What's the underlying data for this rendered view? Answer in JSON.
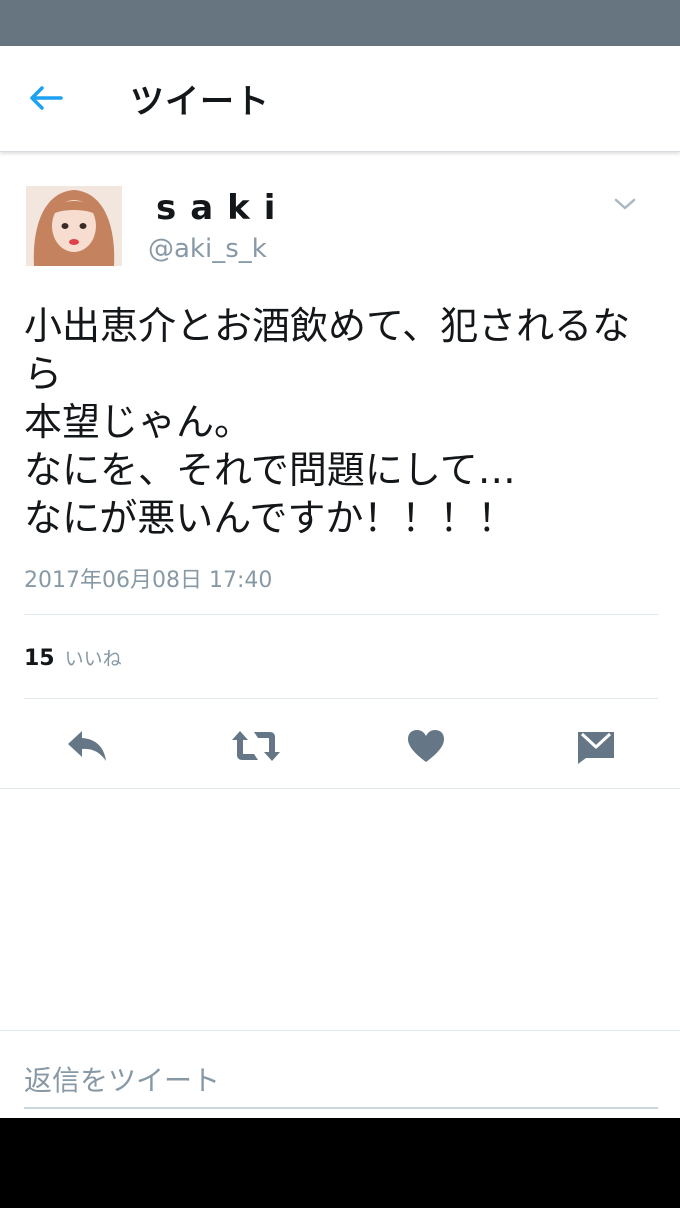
{
  "header": {
    "title": "ツイート"
  },
  "tweet": {
    "display_name": "saki",
    "handle": "@aki_s_k",
    "text": "小出恵介とお酒飲めて、犯されるなら\n本望じゃん。\nなにを、それで問題にして…\nなにが悪いんですか！！！！",
    "timestamp": "2017年06月08日 17:40",
    "likes_count": "15",
    "likes_label": "いいね"
  },
  "reply": {
    "placeholder": "返信をツイート"
  },
  "colors": {
    "accent": "#1da1f2",
    "icon_gray": "#657786",
    "status_bar": "#66757f"
  }
}
